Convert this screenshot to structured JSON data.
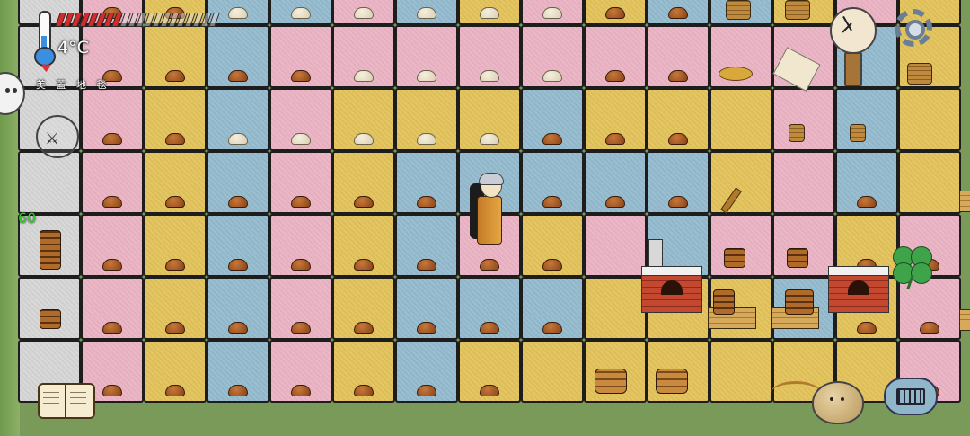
{
  "hud": {
    "temperature": "4°C",
    "biome": "美 蓋 地 毯",
    "fps": "60",
    "food_meter": {
      "filled": 8,
      "total": 20,
      "fill_color": "#d42a2a"
    }
  },
  "icons": {
    "thermometer": "thermometer-icon",
    "heart": "heart-icon",
    "emote": "emote-face-icon",
    "grief": "grief-shield-icon",
    "clock": "clock-icon",
    "settings": "gear-icon",
    "tech_book": "open-book-icon",
    "potato": "potato-icon",
    "keyboard": "keyboard-chat-icon",
    "clover": "four-leaf-clover-icon"
  },
  "palette": {
    "pink": "#e6aebf",
    "yellow": "#ddbd57",
    "blue": "#8fb5c9",
    "gray": "#cfcfcf"
  },
  "board": {
    "rows": 7,
    "cols": 15,
    "tile_colors": [
      [
        "gray",
        "pink",
        "yellow",
        "blue",
        "blue",
        "pink",
        "blue",
        "yellow",
        "pink",
        "yellow",
        "blue",
        "blue",
        "yellow",
        "pink",
        "yellow"
      ],
      [
        "gray",
        "pink",
        "yellow",
        "blue",
        "pink",
        "pink",
        "pink",
        "pink",
        "pink",
        "pink",
        "pink",
        "pink",
        "pink",
        "blue",
        "yellow"
      ],
      [
        "gray",
        "pink",
        "yellow",
        "blue",
        "pink",
        "yellow",
        "yellow",
        "yellow",
        "blue",
        "yellow",
        "yellow",
        "yellow",
        "pink",
        "blue",
        "yellow"
      ],
      [
        "gray",
        "pink",
        "yellow",
        "blue",
        "pink",
        "yellow",
        "blue",
        "blue",
        "blue",
        "blue",
        "blue",
        "yellow",
        "pink",
        "blue",
        "yellow"
      ],
      [
        "gray",
        "pink",
        "yellow",
        "blue",
        "pink",
        "yellow",
        "blue",
        "pink",
        "yellow",
        "pink",
        "blue",
        "pink",
        "pink",
        "yellow",
        "pink"
      ],
      [
        "gray",
        "pink",
        "yellow",
        "blue",
        "pink",
        "yellow",
        "blue",
        "blue",
        "blue",
        "yellow",
        "yellow",
        "yellow",
        "blue",
        "yellow",
        "pink"
      ],
      [
        "gray",
        "pink",
        "yellow",
        "blue",
        "pink",
        "yellow",
        "blue",
        "yellow",
        "yellow",
        "yellow",
        "yellow",
        "yellow",
        "yellow",
        "yellow",
        "pink"
      ]
    ]
  }
}
